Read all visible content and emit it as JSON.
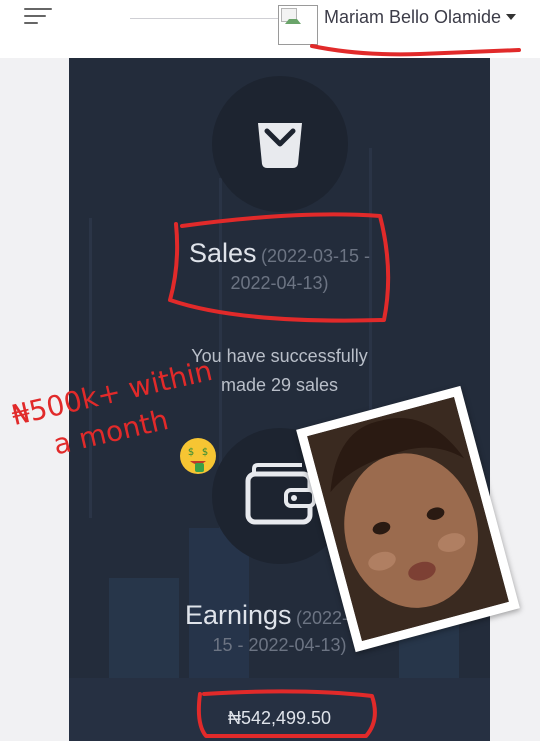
{
  "header": {
    "user_name": "Mariam Bello Olamide",
    "menu_icon": "hamburger-menu-icon",
    "avatar_icon": "broken-image-icon",
    "caret_icon": "caret-down-icon"
  },
  "sales": {
    "icon": "shopping-bag-icon",
    "title": "Sales",
    "range_part1": "(2022-03-15 -",
    "range_part2": "2022-04-13)",
    "description_line1": "You have successfully",
    "description_line2": "made 29 sales"
  },
  "earnings": {
    "icon": "wallet-icon",
    "title": "Earnings",
    "range_part1": "(2022-03-",
    "range_part2": "15 - 2022-04-13)",
    "amount": "₦542,499.50"
  },
  "annotation": {
    "line1": "₦500k+ within",
    "line2": "a month",
    "emoji": "money-mouth-face-icon",
    "color": "#e12a2a"
  },
  "colors": {
    "card_bg": "#232c3b",
    "page_bg": "#f1f1f3",
    "accent_red": "#e12a2a"
  }
}
